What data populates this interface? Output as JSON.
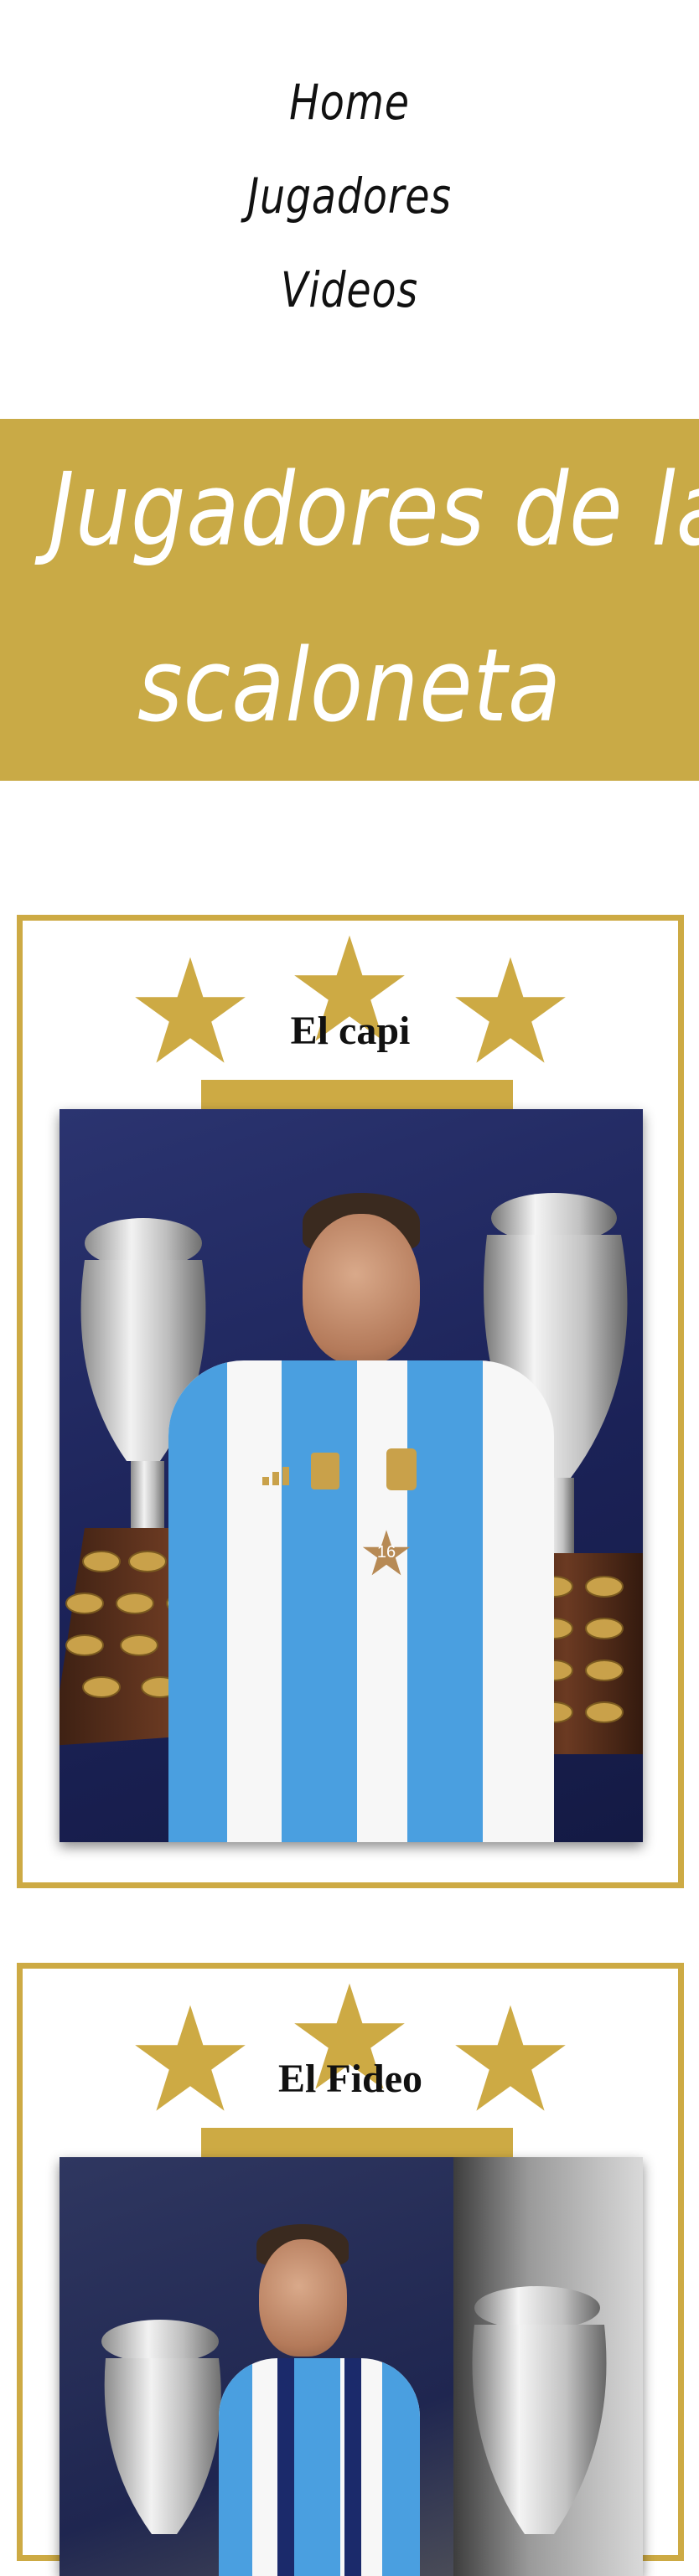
{
  "nav": {
    "home": "Home",
    "players": "Jugadores",
    "videos": "Videos"
  },
  "banner": {
    "line1": "Jugadores de la",
    "line2": "scaloneta"
  },
  "cards": [
    {
      "title": "El capi",
      "jersey_number": "16"
    },
    {
      "title": "El Fideo"
    }
  ],
  "colors": {
    "gold": "#c9aa46",
    "argentina_blue": "#4a9fe0"
  }
}
